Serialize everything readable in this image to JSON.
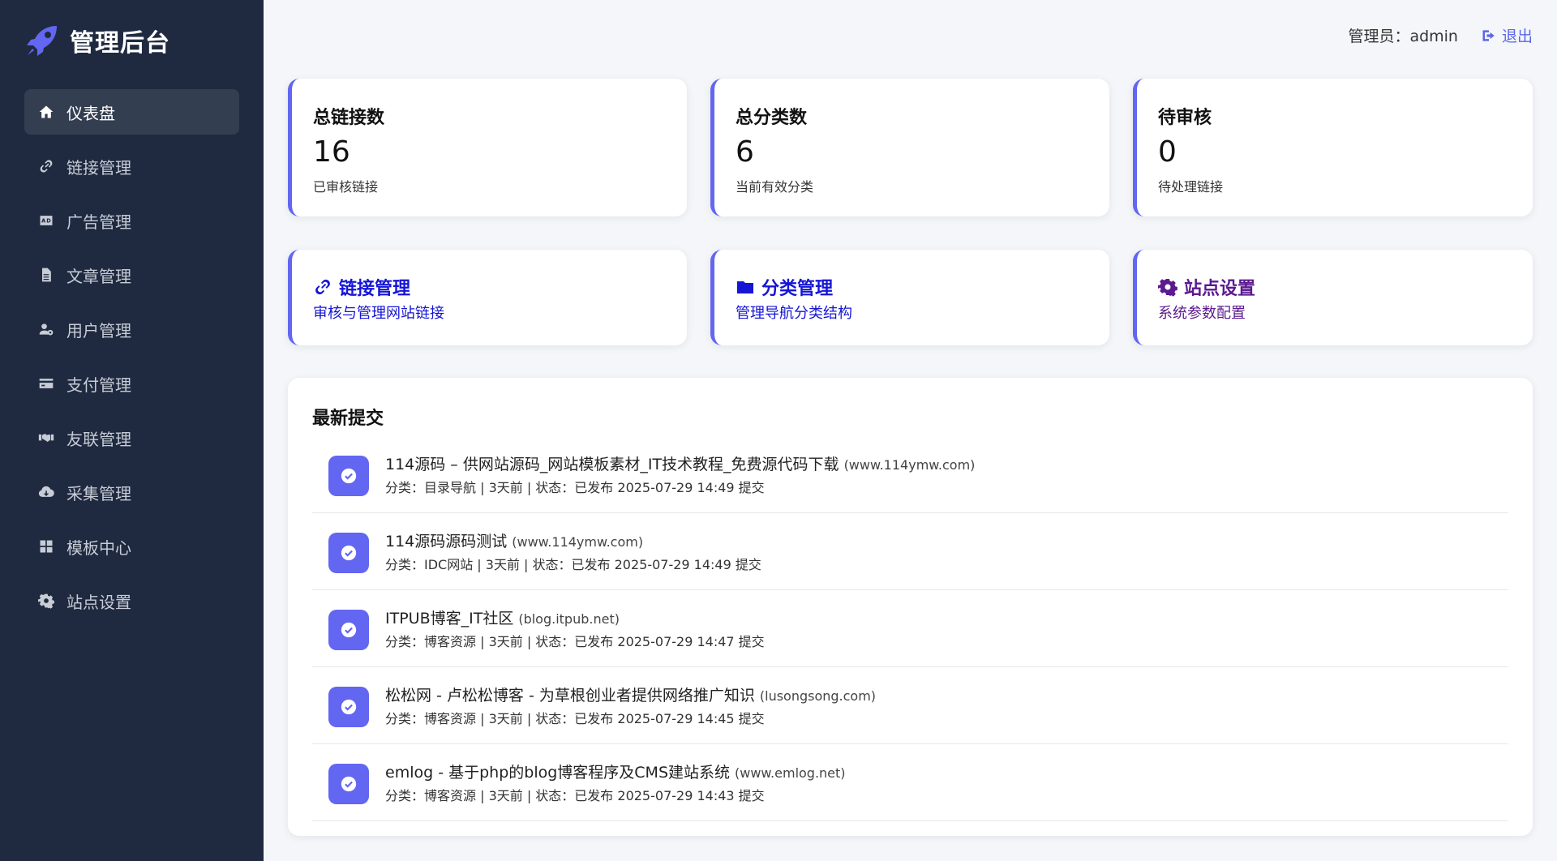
{
  "brand": {
    "title": "管理后台",
    "icon": "rocket-icon"
  },
  "sidebar": {
    "items": [
      {
        "label": "仪表盘",
        "icon": "home-icon",
        "active": true
      },
      {
        "label": "链接管理",
        "icon": "link-icon"
      },
      {
        "label": "广告管理",
        "icon": "ad-icon"
      },
      {
        "label": "文章管理",
        "icon": "file-icon"
      },
      {
        "label": "用户管理",
        "icon": "users-cog-icon"
      },
      {
        "label": "支付管理",
        "icon": "credit-card-icon"
      },
      {
        "label": "友联管理",
        "icon": "handshake-icon"
      },
      {
        "label": "采集管理",
        "icon": "cloud-download-icon"
      },
      {
        "label": "模板中心",
        "icon": "grid-icon"
      },
      {
        "label": "站点设置",
        "icon": "gear-icon"
      }
    ]
  },
  "header": {
    "admin_label": "管理员：admin",
    "logout_label": "退出"
  },
  "stats": [
    {
      "label": "总链接数",
      "value": "16",
      "sub": "已审核链接"
    },
    {
      "label": "总分类数",
      "value": "6",
      "sub": "当前有效分类"
    },
    {
      "label": "待审核",
      "value": "0",
      "sub": "待处理链接"
    }
  ],
  "quick_links": [
    {
      "title": "链接管理",
      "sub": "审核与管理网站链接",
      "icon": "link-icon",
      "color": "#1515d6"
    },
    {
      "title": "分类管理",
      "sub": "管理导航分类结构",
      "icon": "folder-icon",
      "color": "#1515d6"
    },
    {
      "title": "站点设置",
      "sub": "系统参数配置",
      "icon": "gear-icon",
      "color": "#5b1a8f"
    }
  ],
  "colors": {
    "sidebar_bg": "#1f2a40",
    "accent": "#6366f1",
    "link": "#1515d6",
    "settings": "#5b1a8f"
  },
  "recent": {
    "title": "最新提交",
    "items": [
      {
        "title": "114源码 – 供网站源码_网站模板素材_IT技术教程_免费源代码下载",
        "domain": "(www.114ymw.com)",
        "meta": "分类：目录导航 | 3天前 | 状态：已发布 2025-07-29 14:49 提交"
      },
      {
        "title": "114源码源码测试",
        "domain": "(www.114ymw.com)",
        "meta": "分类：IDC网站 | 3天前 | 状态：已发布 2025-07-29 14:49 提交"
      },
      {
        "title": "ITPUB博客_IT社区",
        "domain": "(blog.itpub.net)",
        "meta": "分类：博客资源 | 3天前 | 状态：已发布 2025-07-29 14:47 提交"
      },
      {
        "title": "松松网 - 卢松松博客 - 为草根创业者提供网络推广知识",
        "domain": "(lusongsong.com)",
        "meta": "分类：博客资源 | 3天前 | 状态：已发布 2025-07-29 14:45 提交"
      },
      {
        "title": "emlog - 基于php的blog博客程序及CMS建站系统",
        "domain": "(www.emlog.net)",
        "meta": "分类：博客资源 | 3天前 | 状态：已发布 2025-07-29 14:43 提交"
      }
    ]
  }
}
